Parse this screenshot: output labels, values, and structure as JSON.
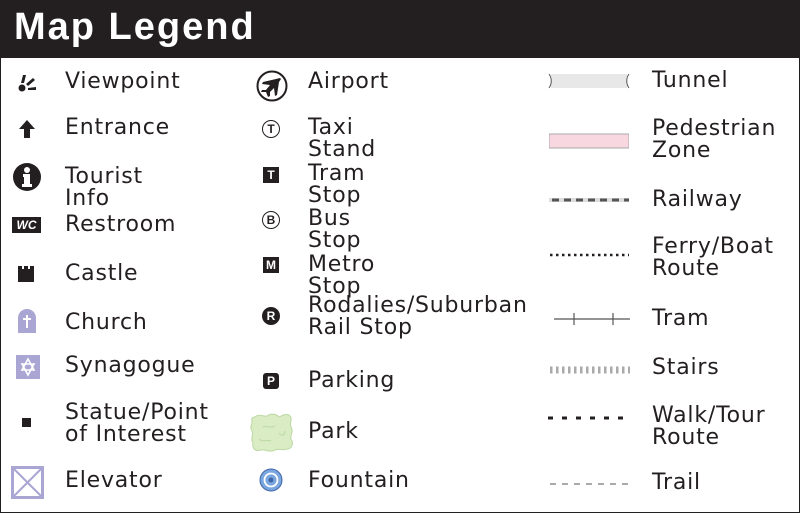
{
  "header": {
    "title": "Map Legend"
  },
  "colors": {
    "header_bg": "#231f20",
    "religious_purple": "#a9a6d4",
    "park_green": "#d9ecc4",
    "fountain_blue": "#7aa6e0",
    "tunnel_gray": "#e8e8e8",
    "pedestrian_pink": "#f8d7e1"
  },
  "columns": {
    "left": [
      {
        "icon": "viewpoint-icon",
        "label": "Viewpoint"
      },
      {
        "icon": "entrance-arrow-icon",
        "label": "Entrance"
      },
      {
        "icon": "tourist-info-icon",
        "label": "Tourist Info"
      },
      {
        "icon": "restroom-wc-icon",
        "label": "Restroom",
        "icon_text": "WC"
      },
      {
        "icon": "castle-icon",
        "label": "Castle"
      },
      {
        "icon": "church-icon",
        "label": "Church"
      },
      {
        "icon": "synagogue-icon",
        "label": "Synagogue"
      },
      {
        "icon": "statue-point-icon",
        "label": "Statue/Point\nof Interest"
      },
      {
        "icon": "elevator-icon",
        "label": "Elevator"
      }
    ],
    "middle": [
      {
        "icon": "airport-icon",
        "label": "Airport"
      },
      {
        "icon": "taxi-stand-icon",
        "label": "Taxi Stand",
        "icon_text": "T"
      },
      {
        "icon": "tram-stop-icon",
        "label": "Tram Stop",
        "icon_text": "T"
      },
      {
        "icon": "bus-stop-icon",
        "label": "Bus Stop",
        "icon_text": "B"
      },
      {
        "icon": "metro-stop-icon",
        "label": "Metro Stop",
        "icon_text": "M"
      },
      {
        "icon": "rodalies-icon",
        "label": "Rodalies/Suburban\nRail Stop",
        "icon_text": "R"
      },
      {
        "icon": "parking-icon",
        "label": "Parking",
        "icon_text": "P"
      },
      {
        "icon": "park-icon",
        "label": "Park"
      },
      {
        "icon": "fountain-icon",
        "label": "Fountain"
      }
    ],
    "right": [
      {
        "icon": "tunnel-line-icon",
        "label": "Tunnel"
      },
      {
        "icon": "pedestrian-zone-icon",
        "label": "Pedestrian\nZone"
      },
      {
        "icon": "railway-line-icon",
        "label": "Railway"
      },
      {
        "icon": "ferry-route-line-icon",
        "label": "Ferry/Boat\nRoute"
      },
      {
        "icon": "tram-line-icon",
        "label": "Tram"
      },
      {
        "icon": "stairs-line-icon",
        "label": "Stairs"
      },
      {
        "icon": "walk-tour-route-line-icon",
        "label": "Walk/Tour\nRoute"
      },
      {
        "icon": "trail-line-icon",
        "label": "Trail"
      }
    ]
  }
}
